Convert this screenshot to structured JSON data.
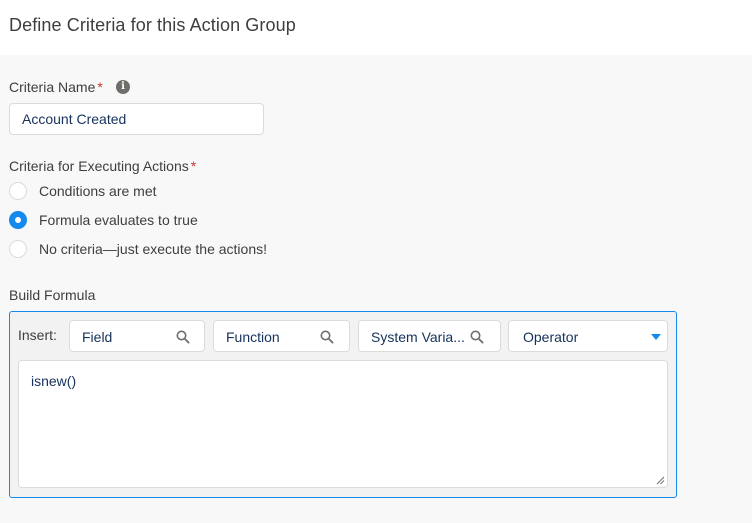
{
  "header": {
    "title": "Define Criteria for this Action Group"
  },
  "criteria_name": {
    "label": "Criteria Name",
    "required_mark": "*",
    "info_glyph": "i",
    "value": "Account Created"
  },
  "criteria_exec": {
    "label": "Criteria for Executing Actions",
    "required_mark": "*",
    "options": [
      {
        "label": "Conditions are met",
        "selected": false
      },
      {
        "label": "Formula evaluates to true",
        "selected": true
      },
      {
        "label": "No criteria—just execute the actions!",
        "selected": false
      }
    ]
  },
  "formula": {
    "label": "Build Formula",
    "insert_label": "Insert:",
    "pickers": [
      {
        "label": "Field",
        "icon": "search-icon"
      },
      {
        "label": "Function",
        "icon": "search-icon"
      },
      {
        "label": "System Varia...",
        "icon": "search-icon"
      },
      {
        "label": "Operator",
        "icon": "chevron-down-icon"
      }
    ],
    "value": "isnew()"
  },
  "colors": {
    "accent": "#1589ee",
    "required": "#c23934",
    "text": "#3e3e3c",
    "input_text": "#16325c"
  }
}
